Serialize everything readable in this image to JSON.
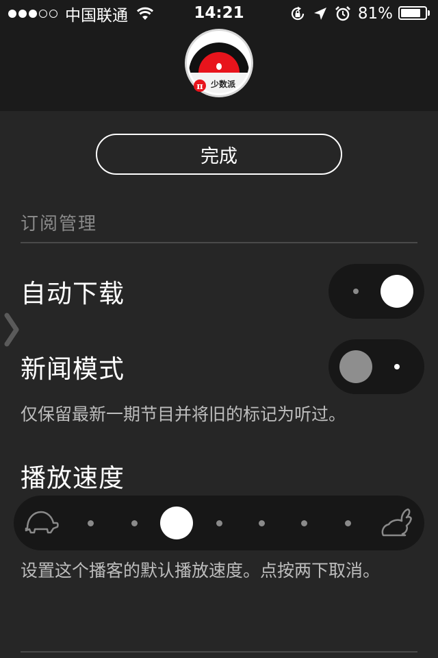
{
  "status_bar": {
    "carrier": "中国联通",
    "signal_bars_filled": 3,
    "signal_bars_total": 5,
    "time": "14:21",
    "battery": "81%",
    "battery_level": 0.81
  },
  "header": {
    "logo_text": "少数派",
    "logo_symbol": "π"
  },
  "done_label": "完成",
  "section": {
    "title": "订阅管理"
  },
  "auto_download": {
    "label": "自动下载",
    "on": true
  },
  "news_mode": {
    "label": "新闻模式",
    "on": false,
    "description": "仅保留最新一期节目并将旧的标记为听过。"
  },
  "playback_speed": {
    "label": "播放速度",
    "steps": 8,
    "selected_index": 2,
    "slow_icon": "turtle-icon",
    "fast_icon": "rabbit-icon",
    "description": "设置这个播客的默认播放速度。点按两下取消。"
  },
  "colors": {
    "background": "#262626",
    "header": "#1b1b1b",
    "control_track": "#171717",
    "logo_red": "#e8141c"
  }
}
